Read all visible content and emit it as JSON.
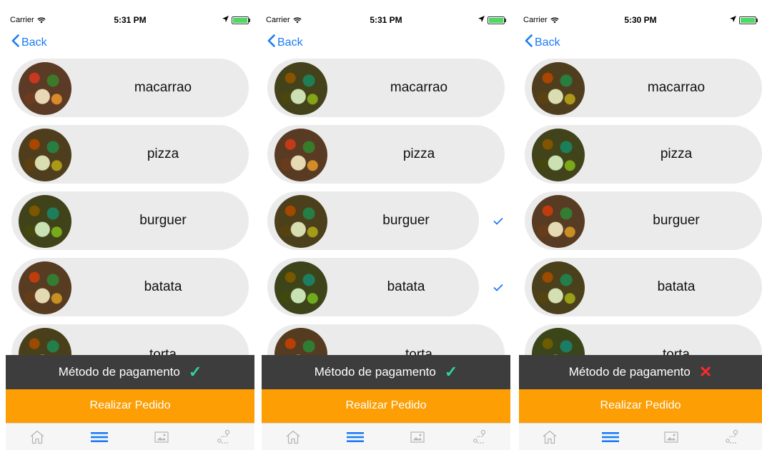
{
  "colors": {
    "accent": "#1a7cf5",
    "order": "#fc9e04",
    "payment_bar": "#3d3d3d",
    "ok": "#2ed3a0",
    "fail": "#ff2a2a"
  },
  "screens": [
    {
      "status": {
        "carrier": "Carrier",
        "time": "5:31 PM"
      },
      "back_label": "Back",
      "items": [
        {
          "name": "macarrao",
          "checked": false
        },
        {
          "name": "pizza",
          "checked": false
        },
        {
          "name": "burguer",
          "checked": false
        },
        {
          "name": "batata",
          "checked": false
        },
        {
          "name": "torta",
          "checked": false
        }
      ],
      "payment_label": "Método de pagamento",
      "payment_ok": true,
      "payment_icon": "✓",
      "order_label": "Realizar Pedido",
      "tabs": [
        "home-icon",
        "menu-icon",
        "image-icon",
        "route-icon"
      ]
    },
    {
      "status": {
        "carrier": "Carrier",
        "time": "5:31 PM"
      },
      "back_label": "Back",
      "items": [
        {
          "name": "macarrao",
          "checked": false
        },
        {
          "name": "pizza",
          "checked": false
        },
        {
          "name": "burguer",
          "checked": true
        },
        {
          "name": "batata",
          "checked": true
        },
        {
          "name": "torta",
          "checked": false
        }
      ],
      "payment_label": "Método de pagamento",
      "payment_ok": true,
      "payment_icon": "✓",
      "order_label": "Realizar Pedido",
      "tabs": [
        "home-icon",
        "menu-icon",
        "image-icon",
        "route-icon"
      ]
    },
    {
      "status": {
        "carrier": "Carrier",
        "time": "5:30 PM"
      },
      "back_label": "Back",
      "items": [
        {
          "name": "macarrao",
          "checked": false
        },
        {
          "name": "pizza",
          "checked": false
        },
        {
          "name": "burguer",
          "checked": false
        },
        {
          "name": "batata",
          "checked": false
        },
        {
          "name": "torta",
          "checked": false
        }
      ],
      "payment_label": "Método de pagamento",
      "payment_ok": false,
      "payment_icon": "✕",
      "order_label": "Realizar Pedido",
      "tabs": [
        "home-icon",
        "menu-icon",
        "image-icon",
        "route-icon"
      ]
    }
  ]
}
